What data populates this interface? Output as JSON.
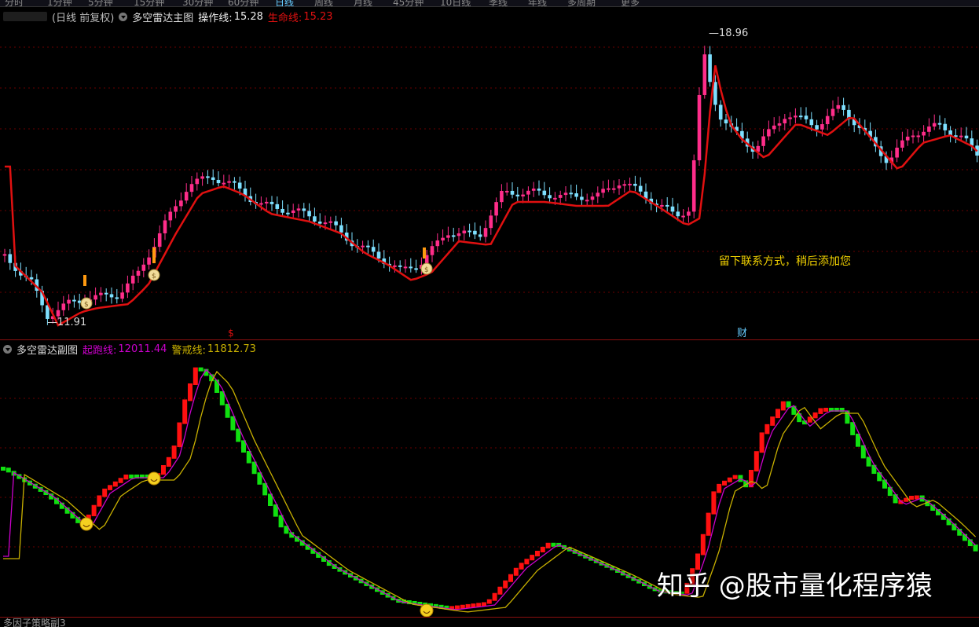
{
  "top_menu": [
    "分时",
    "1分钟",
    "5分钟",
    "15分钟",
    "30分钟",
    "60分钟",
    "日线",
    "周线",
    "月线",
    "45分钟",
    "10日线",
    "季线",
    "年线",
    "多周期",
    "更多"
  ],
  "main": {
    "period_label": "(日线 前复权)",
    "indicator_name": "多空雷达主图",
    "op_line_label": "操作线:",
    "op_line_value": "15.28",
    "life_line_label": "生命线:",
    "life_line_value": "15.23",
    "high_label": "18.96",
    "low_label": "11.91",
    "note": "留下联系方式，稍后添加您",
    "markers": [
      "$",
      "财"
    ]
  },
  "sub": {
    "indicator_name": "多空雷达副图",
    "start_line_label": "起跑线:",
    "start_line_value": "12011.44",
    "warn_line_label": "警戒线:",
    "warn_line_value": "11812.73"
  },
  "footer_hint": "多因子策略副3",
  "watermark": "知乎 @股市量化程序猿",
  "colors": {
    "up": "#ff2d8a",
    "down": "#7ee0ff",
    "life_line": "#e01010",
    "start_line": "#cc00cc",
    "warn_line": "#c8b000",
    "bar_up": "#ff1010",
    "bar_down": "#10e010"
  }
}
